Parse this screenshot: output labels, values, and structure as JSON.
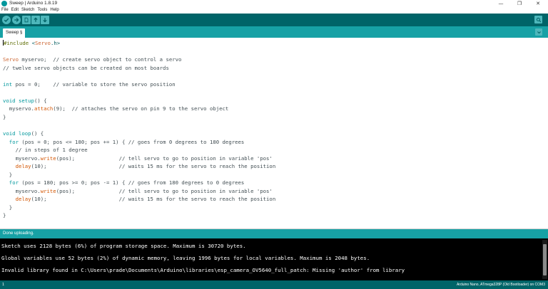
{
  "window": {
    "title": "Sweep | Arduino 1.8.19",
    "minimize": "—",
    "maximize": "❐",
    "close": "✕"
  },
  "menu": [
    "File",
    "Edit",
    "Sketch",
    "Tools",
    "Help"
  ],
  "toolbar": {
    "buttons": [
      "verify",
      "upload",
      "new",
      "open",
      "save"
    ],
    "serial_monitor": "serial-monitor"
  },
  "tabs": [
    {
      "label": "Sweep §"
    }
  ],
  "editor": {
    "lines": [
      "#include <Servo.h>",
      "",
      "Servo myservo;  // create servo object to control a servo",
      "// twelve servo objects can be created on most boards",
      "",
      "int pos = 0;    // variable to store the servo position",
      "",
      "void setup() {",
      "  myservo.attach(9);  // attaches the servo on pin 9 to the servo object",
      "}",
      "",
      "void loop() {",
      "  for (pos = 0; pos <= 180; pos += 1) { // goes from 0 degrees to 180 degrees",
      "    // in steps of 1 degree",
      "    myservo.write(pos);              // tell servo to go to position in variable 'pos'",
      "    delay(10);                       // waits 15 ms for the servo to reach the position",
      "  }",
      "  for (pos = 180; pos >= 0; pos -= 1) { // goes from 180 degrees to 0 degrees",
      "    myservo.write(pos);              // tell servo to go to position in variable 'pos'",
      "    delay(10);                       // waits 15 ms for the servo to reach the position",
      "  }",
      "}"
    ]
  },
  "status": {
    "message": "Done uploading."
  },
  "console": {
    "lines": [
      "Sketch uses 2128 bytes (6%) of program storage space. Maximum is 30720 bytes.",
      "Global variables use 52 bytes (2%) of dynamic memory, leaving 1996 bytes for local variables. Maximum is 2048 bytes.",
      "Invalid library found in C:\\Users\\prade\\Documents\\Arduino\\libraries\\esp_camera_OV5640_full_patch: Missing 'author' from library"
    ]
  },
  "bottom": {
    "line_number": "1",
    "board": "Arduino Nano, ATmega328P (Old Bootloader) on COM3"
  },
  "colors": {
    "toolbar": "#006468",
    "tabbar": "#17a1a5",
    "button": "#4db7bb",
    "console_bg": "#000000"
  }
}
